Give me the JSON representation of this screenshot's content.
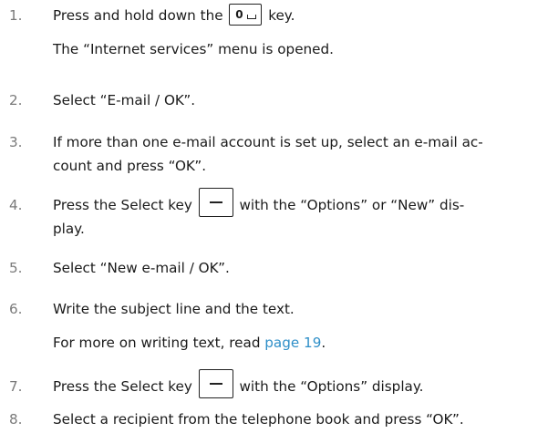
{
  "steps": [
    {
      "num": "1.",
      "l1a": "Press and hold down the",
      "key": "0",
      "l1b": "key.",
      "l2": "The “Internet services” menu is opened."
    },
    {
      "num": "2.",
      "text": "Select “E-mail / OK”."
    },
    {
      "num": "3.",
      "l1": "If more than one e-mail account is set up, select an e-mail ac-",
      "l2": "count and press “OK”."
    },
    {
      "num": "4.",
      "l1a": "Press the Select key",
      "l1b": "with the “Options” or “New” dis-",
      "l2": "play."
    },
    {
      "num": "5.",
      "text": "Select “New e-mail / OK”."
    },
    {
      "num": "6.",
      "text": "Write the subject line and the text.",
      "l2a": "For more on writing text, read ",
      "link": "page 19",
      "l2b": "."
    },
    {
      "num": "7.",
      "l1a": "Press the Select key",
      "l1b": "with the “Options” display."
    },
    {
      "num": "8.",
      "text": "Select a recipient from the telephone book and press “OK”."
    }
  ]
}
